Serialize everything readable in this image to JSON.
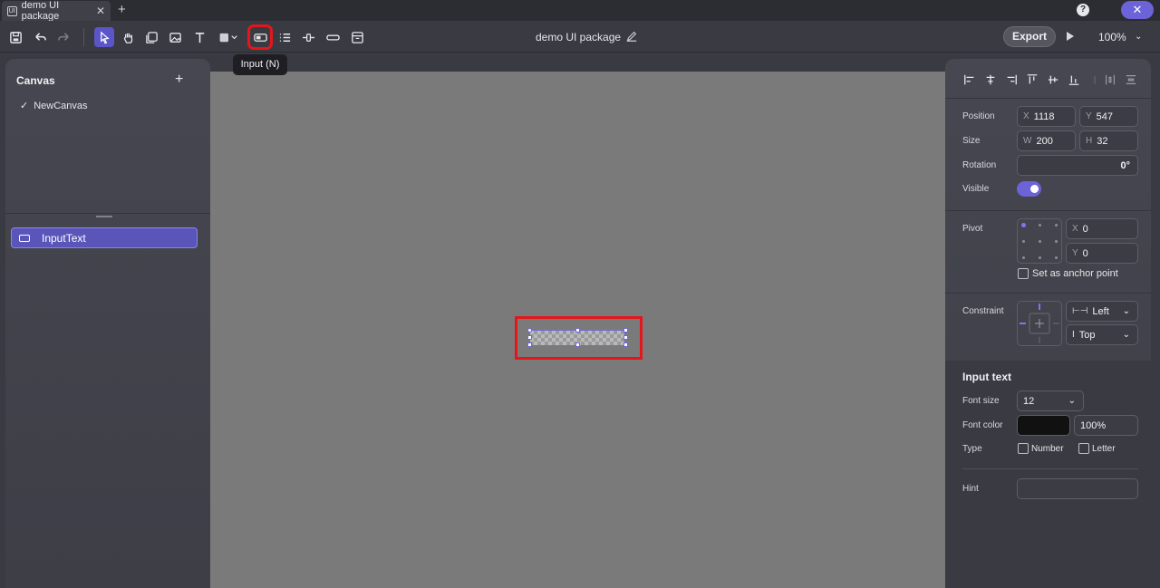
{
  "tab": {
    "title": "demo UI package"
  },
  "toolbar": {
    "doc_title": "demo UI package",
    "export_label": "Export",
    "zoom": "100%",
    "tooltip": "Input (N)"
  },
  "left_panel": {
    "title": "Canvas",
    "canvas_item": "NewCanvas",
    "layer_item": "InputText"
  },
  "right_panel": {
    "position_label": "Position",
    "pos_x_prefix": "X",
    "pos_x": "1118",
    "pos_y_prefix": "Y",
    "pos_y": "547",
    "size_label": "Size",
    "width_prefix": "W",
    "width": "200",
    "height_prefix": "H",
    "height": "32",
    "rotation_label": "Rotation",
    "rotation": "0°",
    "visible_label": "Visible",
    "pivot_label": "Pivot",
    "pivot_x_prefix": "X",
    "pivot_x": "0",
    "pivot_y_prefix": "Y",
    "pivot_y": "0",
    "anchor_label": "Set as anchor point",
    "constraint_label": "Constraint",
    "constraint_h": "Left",
    "constraint_v": "Top",
    "section_title": "Input text",
    "font_size_label": "Font size",
    "font_size": "12",
    "font_color_label": "Font color",
    "font_opacity": "100%",
    "type_label": "Type",
    "type_number": "Number",
    "type_letter": "Letter",
    "hint_label": "Hint",
    "hint_value": ""
  },
  "colors": {
    "accent": "#6c63d9",
    "highlight": "#e4161b",
    "canvas": "#7a7a7a",
    "font_color": "#111111"
  }
}
